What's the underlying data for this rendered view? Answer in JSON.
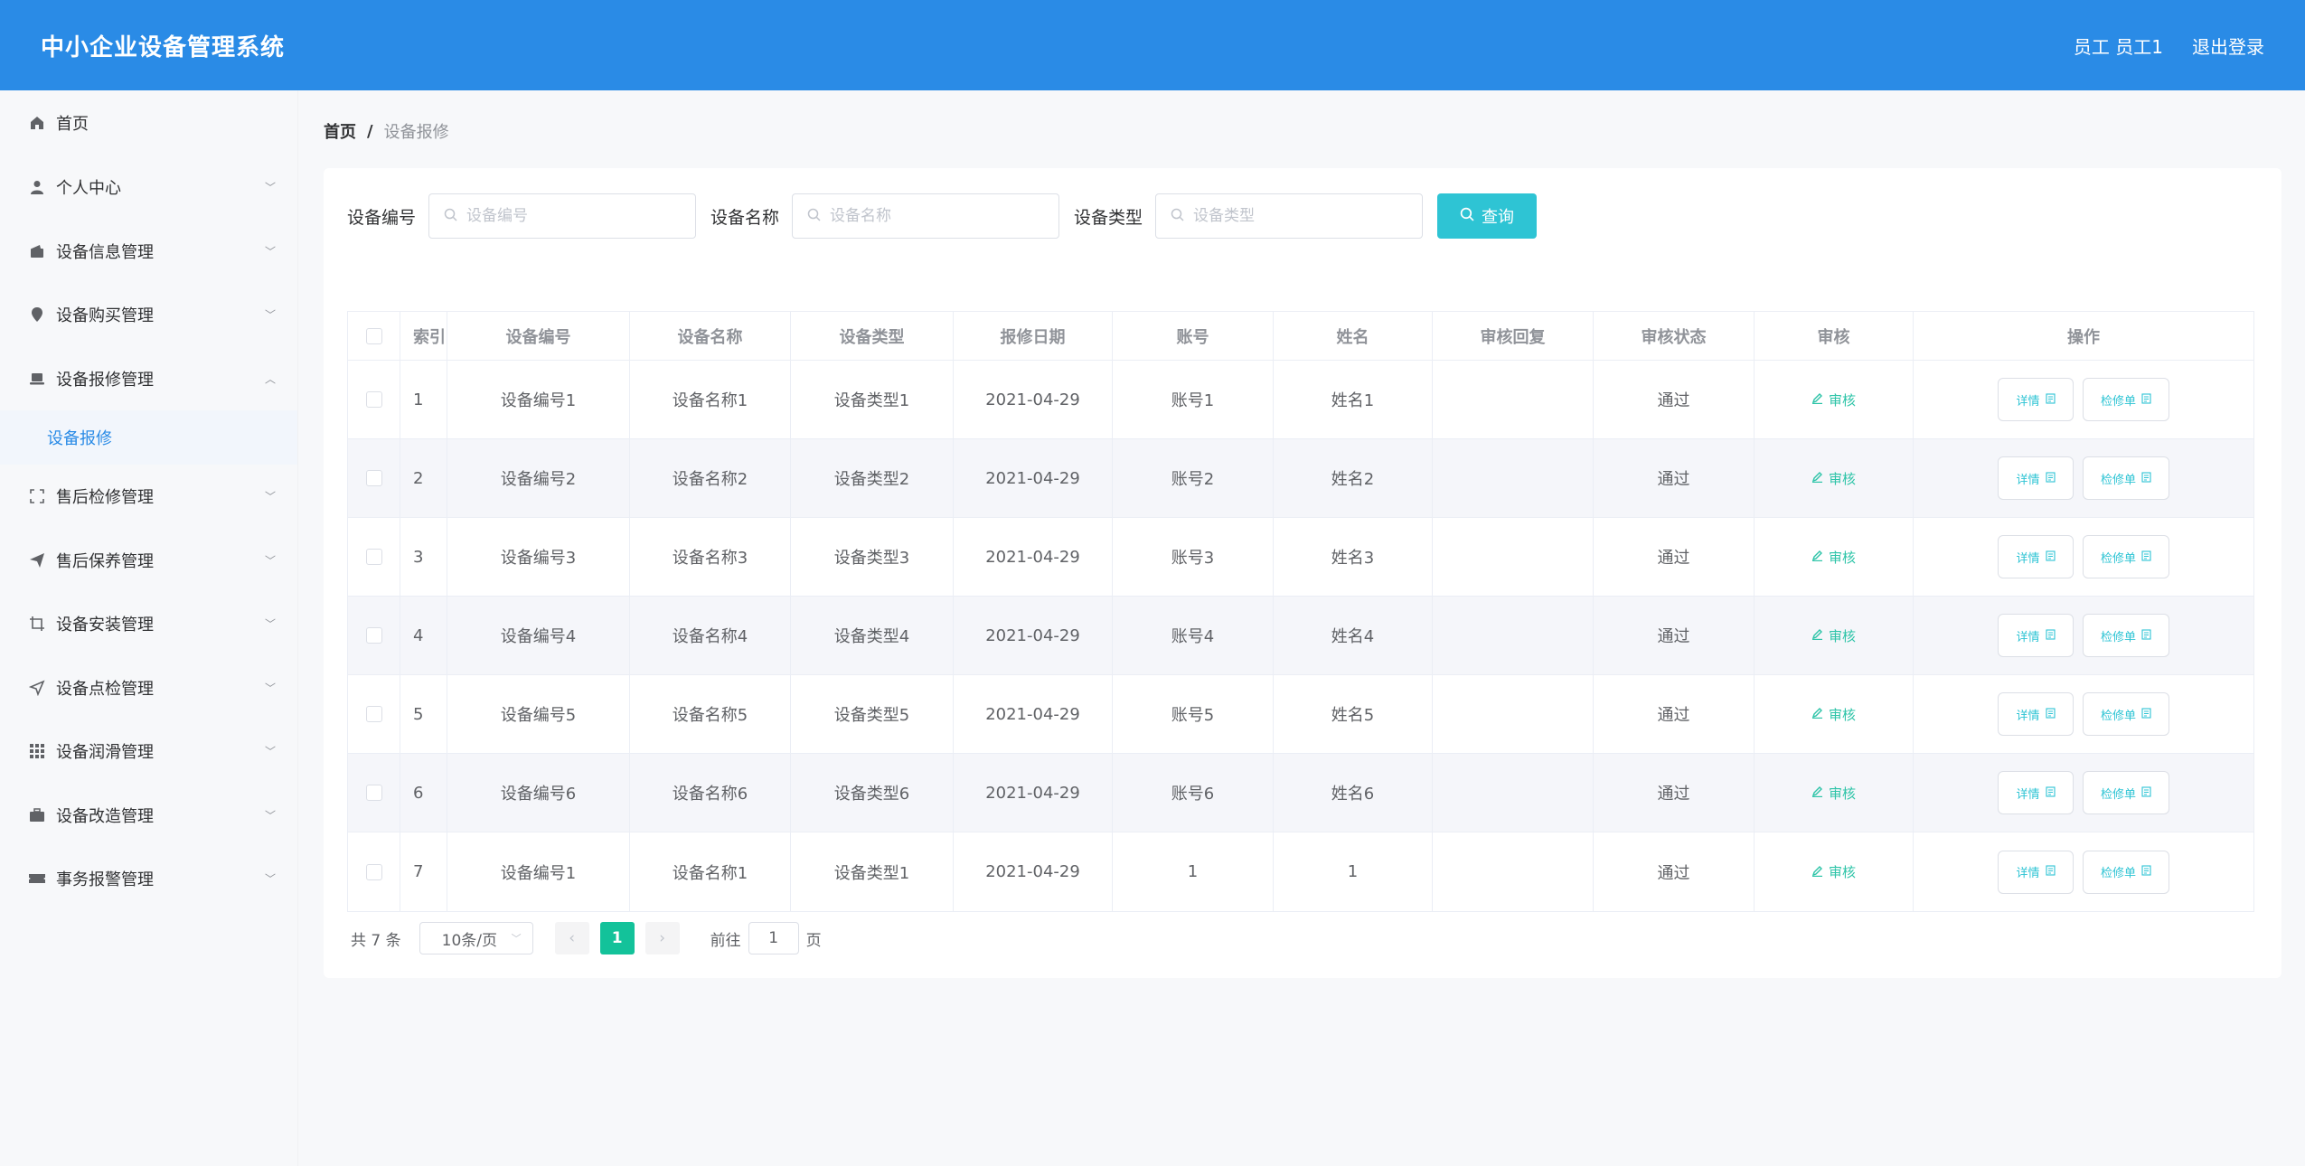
{
  "header": {
    "title": "中小企业设备管理系统",
    "user": "员工 员工1",
    "logout": "退出登录"
  },
  "sidebar": {
    "items": [
      {
        "label": "首页",
        "icon": "home-icon"
      },
      {
        "label": "个人中心",
        "icon": "user-icon"
      },
      {
        "label": "设备信息管理",
        "icon": "wallet-icon"
      },
      {
        "label": "设备购买管理",
        "icon": "location-pin-icon"
      },
      {
        "label": "设备报修管理",
        "icon": "laptop-icon"
      },
      {
        "label": "售后检修管理",
        "icon": "fullscreen-icon"
      },
      {
        "label": "售后保养管理",
        "icon": "send-icon"
      },
      {
        "label": "设备安装管理",
        "icon": "crop-icon"
      },
      {
        "label": "设备点检管理",
        "icon": "position-icon"
      },
      {
        "label": "设备润滑管理",
        "icon": "grid-icon"
      },
      {
        "label": "设备改造管理",
        "icon": "briefcase-icon"
      },
      {
        "label": "事务报警管理",
        "icon": "ticket-icon"
      }
    ],
    "submenu": {
      "label": "设备报修"
    }
  },
  "breadcrumb": {
    "home": "首页",
    "sep": "/",
    "current": "设备报修"
  },
  "search": {
    "label_no": "设备编号",
    "placeholder_no": "设备编号",
    "label_name": "设备名称",
    "placeholder_name": "设备名称",
    "label_type": "设备类型",
    "placeholder_type": "设备类型",
    "query": "查询"
  },
  "table": {
    "headers": {
      "index": "索引",
      "no": "设备编号",
      "name": "设备名称",
      "type": "设备类型",
      "date": "报修日期",
      "account": "账号",
      "xm": "姓名",
      "reply": "审核回复",
      "status": "审核状态",
      "audit": "审核",
      "ops": "操作"
    },
    "rows": [
      {
        "index": "1",
        "no": "设备编号1",
        "name": "设备名称1",
        "type": "设备类型1",
        "date": "2021-04-29",
        "account": "账号1",
        "xm": "姓名1",
        "reply": "",
        "status": "通过"
      },
      {
        "index": "2",
        "no": "设备编号2",
        "name": "设备名称2",
        "type": "设备类型2",
        "date": "2021-04-29",
        "account": "账号2",
        "xm": "姓名2",
        "reply": "",
        "status": "通过"
      },
      {
        "index": "3",
        "no": "设备编号3",
        "name": "设备名称3",
        "type": "设备类型3",
        "date": "2021-04-29",
        "account": "账号3",
        "xm": "姓名3",
        "reply": "",
        "status": "通过"
      },
      {
        "index": "4",
        "no": "设备编号4",
        "name": "设备名称4",
        "type": "设备类型4",
        "date": "2021-04-29",
        "account": "账号4",
        "xm": "姓名4",
        "reply": "",
        "status": "通过"
      },
      {
        "index": "5",
        "no": "设备编号5",
        "name": "设备名称5",
        "type": "设备类型5",
        "date": "2021-04-29",
        "account": "账号5",
        "xm": "姓名5",
        "reply": "",
        "status": "通过"
      },
      {
        "index": "6",
        "no": "设备编号6",
        "name": "设备名称6",
        "type": "设备类型6",
        "date": "2021-04-29",
        "account": "账号6",
        "xm": "姓名6",
        "reply": "",
        "status": "通过"
      },
      {
        "index": "7",
        "no": "设备编号1",
        "name": "设备名称1",
        "type": "设备类型1",
        "date": "2021-04-29",
        "account": "1",
        "xm": "1",
        "reply": "",
        "status": "通过"
      }
    ],
    "audit_label": "审核",
    "detail_label": "详情",
    "repair_label": "检修单"
  },
  "pager": {
    "total": "共 7 条",
    "page_size": "10条/页",
    "current_page": "1",
    "goto_prefix": "前往",
    "goto_value": "1",
    "goto_suffix": "页"
  },
  "colors": {
    "header_bg": "#2a8be6",
    "accent_cyan": "#2ec4d4",
    "audit_green": "#2ec4a8",
    "page_active": "#13c29a"
  }
}
